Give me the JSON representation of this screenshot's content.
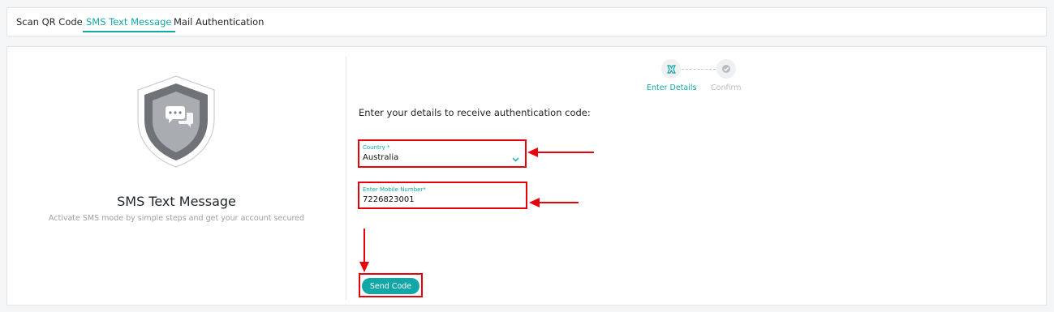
{
  "tabs": [
    {
      "label": "Scan QR Code"
    },
    {
      "label": "SMS Text Message"
    },
    {
      "label": "Mail Authentication"
    }
  ],
  "active_tab": "SMS Text Message",
  "left_panel": {
    "title": "SMS Text Message",
    "description": "Activate SMS mode by simple steps and get your account secured",
    "icon": "shield-chat-icon"
  },
  "steps": [
    {
      "label": "Enter Details",
      "state": "active"
    },
    {
      "label": "Confirm",
      "state": "pending"
    }
  ],
  "form": {
    "instruction": "Enter your details to receive authentication code:",
    "country": {
      "label": "Country *",
      "value": "Australia"
    },
    "mobile": {
      "label": "Enter Mobile Number*",
      "value": "7226823001"
    },
    "send_label": "Send Code"
  },
  "colors": {
    "accent": "#11a7a7",
    "annotation": "#e8000b"
  }
}
